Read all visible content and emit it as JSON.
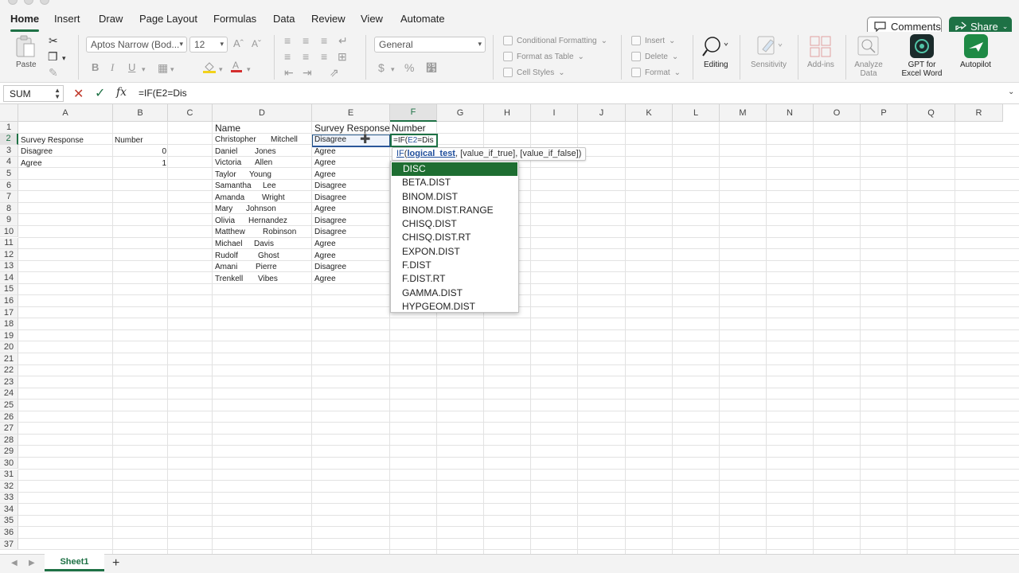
{
  "ribbon_tabs": [
    "Home",
    "Insert",
    "Draw",
    "Page Layout",
    "Formulas",
    "Data",
    "Review",
    "View",
    "Automate"
  ],
  "header": {
    "comments": "Comments",
    "share": "Share"
  },
  "ribbon": {
    "paste": "Paste",
    "font_name": "Aptos Narrow (Bod...",
    "font_size": "12",
    "bold": "B",
    "italic": "I",
    "underline": "U",
    "number_format": "General",
    "currency": "$",
    "percent": "%",
    "conditional_formatting": "Conditional Formatting",
    "format_as_table": "Format as Table",
    "cell_styles": "Cell Styles",
    "insert": "Insert",
    "delete": "Delete",
    "format": "Format",
    "editing": "Editing",
    "sensitivity": "Sensitivity",
    "add_ins": "Add-ins",
    "analyze_data": [
      "Analyze",
      "Data"
    ],
    "gpt": [
      "GPT for",
      "Excel Word"
    ],
    "autopilot": "Autopilot"
  },
  "formula_bar": {
    "name_box": "SUM",
    "formula": "=IF(E2=Dis"
  },
  "columns": [
    "A",
    "B",
    "C",
    "D",
    "E",
    "F",
    "G",
    "H",
    "I",
    "J",
    "K",
    "L",
    "M",
    "N",
    "O",
    "P",
    "Q",
    "R"
  ],
  "rows": [
    "1",
    "2",
    "3",
    "4",
    "5",
    "6",
    "7",
    "8",
    "9",
    "10",
    "11",
    "12",
    "13",
    "14",
    "15",
    "16",
    "17",
    "18",
    "19",
    "20",
    "21",
    "22",
    "23",
    "24",
    "25",
    "26",
    "27",
    "28",
    "29",
    "30",
    "31",
    "32",
    "33",
    "34",
    "35",
    "36",
    "37"
  ],
  "lookup_table": {
    "header": [
      "Survey Response",
      "Number"
    ],
    "rows": [
      [
        "Disagree",
        "0"
      ],
      [
        "Agree",
        "1"
      ]
    ]
  },
  "main_table": {
    "headers": [
      "Name",
      "Survey Response",
      "Number"
    ],
    "rows": [
      {
        "first": "Christopher",
        "last": "Mitchell",
        "response": "Disagree"
      },
      {
        "first": "Daniel",
        "last": "Jones",
        "response": "Agree"
      },
      {
        "first": "Victoria",
        "last": "Allen",
        "response": "Agree"
      },
      {
        "first": "Taylor",
        "last": "Young",
        "response": "Agree"
      },
      {
        "first": "Samantha",
        "last": "Lee",
        "response": "Disagree"
      },
      {
        "first": "Amanda",
        "last": "Wright",
        "response": "Disagree"
      },
      {
        "first": "Mary",
        "last": "Johnson",
        "response": "Agree"
      },
      {
        "first": "Olivia",
        "last": "Hernandez",
        "response": "Disagree"
      },
      {
        "first": "Matthew",
        "last": "Robinson",
        "response": "Disagree"
      },
      {
        "first": "Michael",
        "last": "Davis",
        "response": "Agree"
      },
      {
        "first": "Rudolf",
        "last": "Ghost",
        "response": "Agree"
      },
      {
        "first": "Amani",
        "last": "Pierre",
        "response": "Disagree"
      },
      {
        "first": "Trenkell",
        "last": "Vibes",
        "response": "Agree"
      }
    ]
  },
  "edit_cell": {
    "prefix": "=IF(",
    "ref": "E2",
    "suffix": "=Dis"
  },
  "tooltip": {
    "fn": "IF",
    "open": "(",
    "current_arg": "logical_test",
    "rest": ", [value_if_true], [value_if_false])"
  },
  "autocomplete": [
    "DISC",
    "BETA.DIST",
    "BINOM.DIST",
    "BINOM.DIST.RANGE",
    "CHISQ.DIST",
    "CHISQ.DIST.RT",
    "EXPON.DIST",
    "F.DIST",
    "F.DIST.RT",
    "GAMMA.DIST",
    "HYPGEOM.DIST"
  ],
  "sheets": [
    "Sheet1"
  ],
  "colors": {
    "accent": "#1e7145",
    "selection_blue": "#2b579a",
    "cancel_red": "#c0392b"
  }
}
